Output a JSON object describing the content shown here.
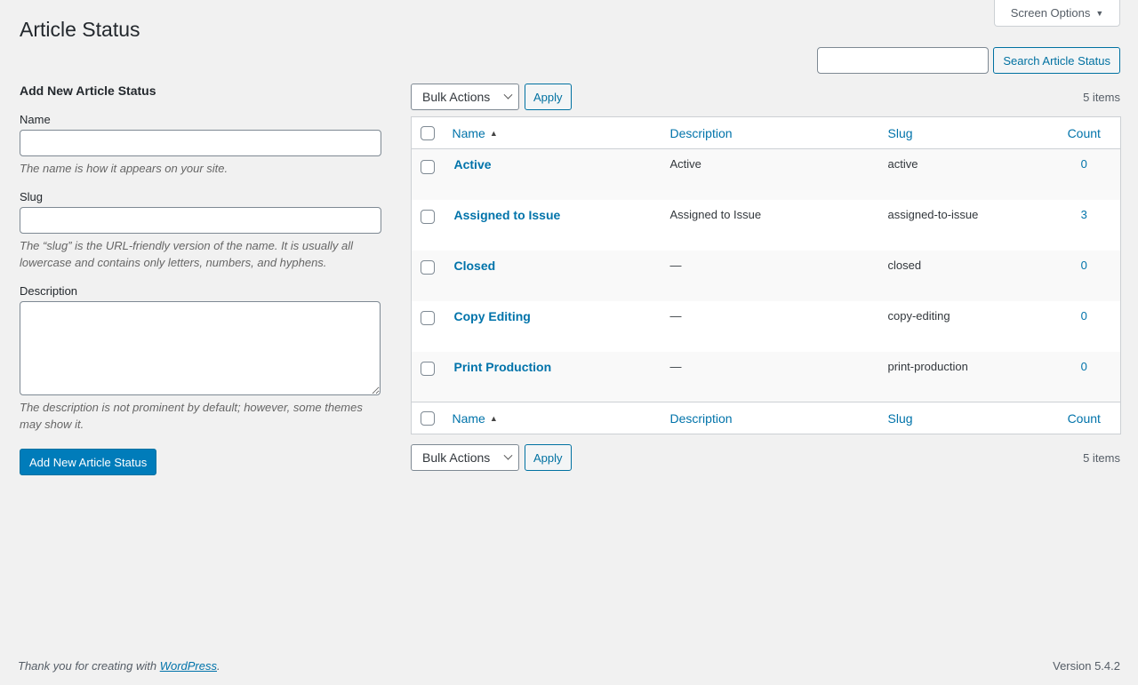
{
  "screen_options": {
    "label": "Screen Options",
    "arrow": "▼"
  },
  "page": {
    "title": "Article Status"
  },
  "search": {
    "placeholder": "",
    "value": "",
    "button_label": "Search Article Status"
  },
  "form": {
    "heading": "Add New Article Status",
    "name": {
      "label": "Name",
      "value": "",
      "hint": "The name is how it appears on your site."
    },
    "slug": {
      "label": "Slug",
      "value": "",
      "hint": "The “slug” is the URL-friendly version of the name. It is usually all lowercase and contains only letters, numbers, and hyphens."
    },
    "description": {
      "label": "Description",
      "value": "",
      "hint": "The description is not prominent by default; however, some themes may show it."
    },
    "submit_label": "Add New Article Status"
  },
  "tablenav": {
    "bulk_actions_label": "Bulk Actions",
    "apply_label": "Apply",
    "items_count": "5 items"
  },
  "table": {
    "columns": {
      "name": "Name",
      "description": "Description",
      "slug": "Slug",
      "count": "Count"
    },
    "sort_indicator": "▲",
    "rows": [
      {
        "name": "Active",
        "description": "Active",
        "slug": "active",
        "count": "0"
      },
      {
        "name": "Assigned to Issue",
        "description": "Assigned to Issue",
        "slug": "assigned-to-issue",
        "count": "3"
      },
      {
        "name": "Closed",
        "description": "—",
        "slug": "closed",
        "count": "0"
      },
      {
        "name": "Copy Editing",
        "description": "—",
        "slug": "copy-editing",
        "count": "0"
      },
      {
        "name": "Print Production",
        "description": "—",
        "slug": "print-production",
        "count": "0"
      }
    ]
  },
  "footer": {
    "thanks_prefix": "Thank you for creating with ",
    "link_label": "WordPress",
    "thanks_suffix": ".",
    "version": "Version 5.4.2"
  },
  "colors": {
    "link": "#0073aa",
    "primary": "#007cba",
    "background": "#f1f1f1"
  }
}
